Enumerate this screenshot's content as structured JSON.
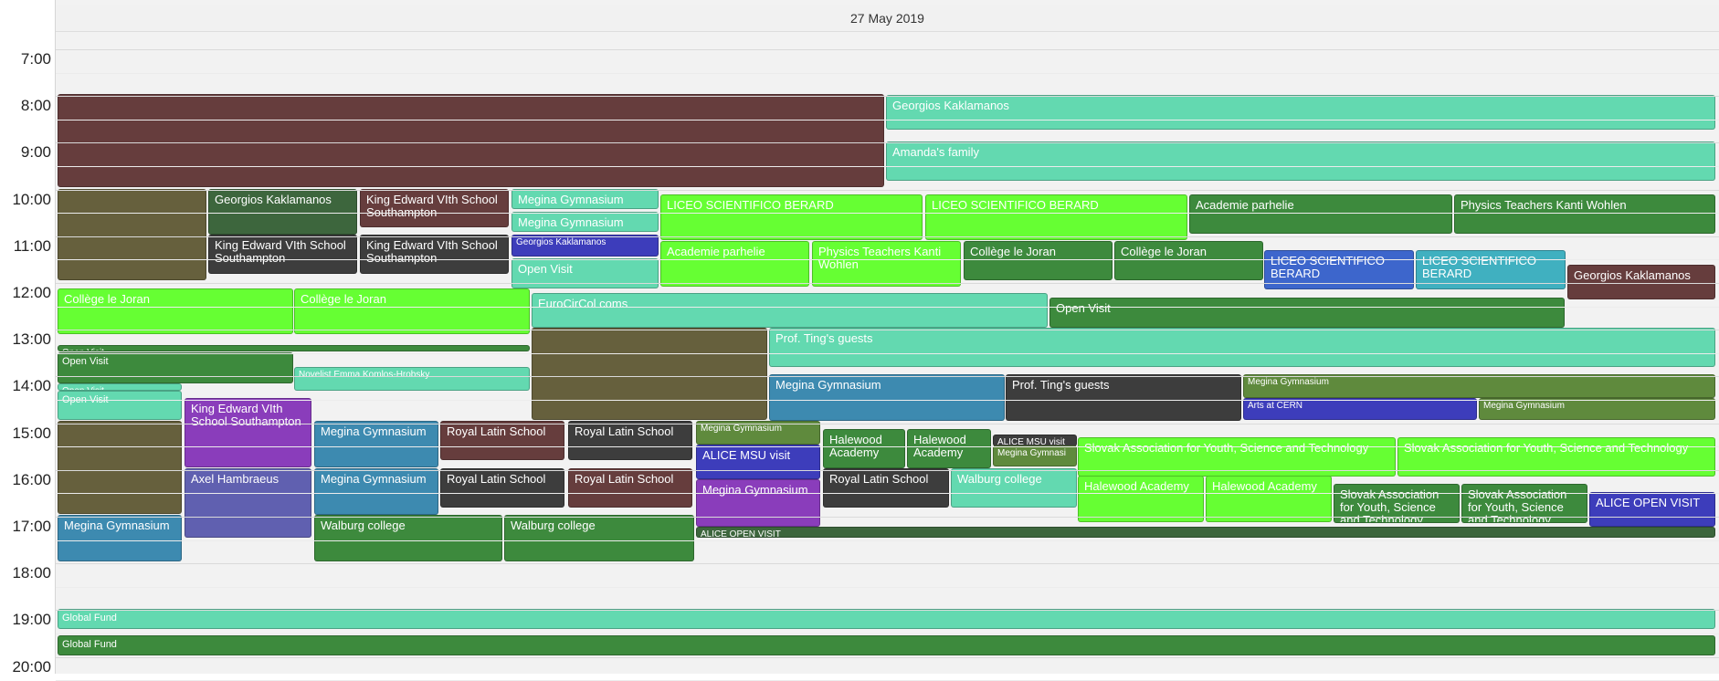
{
  "date_label": "27 May 2019",
  "hours": [
    "7:00",
    "8:00",
    "9:00",
    "10:00",
    "11:00",
    "12:00",
    "13:00",
    "14:00",
    "15:00",
    "16:00",
    "17:00",
    "18:00",
    "19:00",
    "20:00"
  ],
  "colors": {
    "maroon": "#663d3d",
    "olive": "#66603d",
    "darkgreen": "#3d663d",
    "mint": "#63d9b0",
    "lime": "#66ff33",
    "blue": "#3d66cc",
    "teal": "#40b0c0",
    "steel": "#3d8ab0",
    "dark": "#3d3d3d",
    "purple": "#8a3dbb",
    "indigo": "#3d3dbb",
    "slate": "#6060b0",
    "green": "#3d8a3d",
    "moss": "#5f8a3d"
  },
  "events": [
    {
      "id": "e1",
      "label": "",
      "color": "maroon"
    },
    {
      "id": "e2",
      "label": "Georgios Kaklamanos",
      "color": "mint"
    },
    {
      "id": "e3",
      "label": "Amanda's family",
      "color": "mint"
    },
    {
      "id": "e4",
      "label": "",
      "color": "olive"
    },
    {
      "id": "e5",
      "label": "Georgios Kaklamanos",
      "color": "darkgreen"
    },
    {
      "id": "e6",
      "label": "King Edward VIth School Southampton",
      "color": "maroon"
    },
    {
      "id": "e7",
      "label": "Megina Gymnasium",
      "color": "mint"
    },
    {
      "id": "e8",
      "label": "Megina Gymnasium",
      "color": "mint"
    },
    {
      "id": "e9",
      "label": "Georgios Kaklamanos",
      "color": "indigo"
    },
    {
      "id": "e10",
      "label": "Open Visit",
      "color": "mint"
    },
    {
      "id": "e11",
      "label": "LICEO SCIENTIFICO BERARD",
      "color": "lime"
    },
    {
      "id": "e12",
      "label": "LICEO SCIENTIFICO BERARD",
      "color": "lime"
    },
    {
      "id": "e13",
      "label": "Academie parhelie",
      "color": "green"
    },
    {
      "id": "e14",
      "label": "Physics Teachers Kanti Wohlen",
      "color": "green"
    },
    {
      "id": "e15",
      "label": "King Edward VIth School Southampton",
      "color": "dark"
    },
    {
      "id": "e16",
      "label": "King Edward VIth School Southampton",
      "color": "dark"
    },
    {
      "id": "e17",
      "label": "Academie parhelie",
      "color": "lime"
    },
    {
      "id": "e18",
      "label": "Physics Teachers Kanti Wohlen",
      "color": "lime"
    },
    {
      "id": "e19",
      "label": "Collège le Joran",
      "color": "green"
    },
    {
      "id": "e20",
      "label": "Collège le Joran",
      "color": "green"
    },
    {
      "id": "e21",
      "label": "LICEO SCIENTIFICO BERARD",
      "color": "blue"
    },
    {
      "id": "e22",
      "label": "LICEO SCIENTIFICO BERARD",
      "color": "teal"
    },
    {
      "id": "e23",
      "label": "Georgios Kaklamanos",
      "color": "maroon"
    },
    {
      "id": "e24",
      "label": "Collège le Joran",
      "color": "lime"
    },
    {
      "id": "e25",
      "label": "Collège le Joran",
      "color": "lime"
    },
    {
      "id": "e26",
      "label": "EuroCirCol coms",
      "color": "mint"
    },
    {
      "id": "e27",
      "label": "Open Visit",
      "color": "green"
    },
    {
      "id": "e28",
      "label": "",
      "color": "olive"
    },
    {
      "id": "e29",
      "label": "Prof. Ting's guests",
      "color": "mint"
    },
    {
      "id": "e30",
      "label": "Open Visit",
      "color": "green"
    },
    {
      "id": "e31",
      "label": "Open Visit",
      "color": "green"
    },
    {
      "id": "e32",
      "label": "Novelist Emma Komlos-Hrobsky",
      "color": "mint"
    },
    {
      "id": "e33",
      "label": "Open Visit",
      "color": "mint"
    },
    {
      "id": "e34",
      "label": "Megina Gymnasium",
      "color": "steel"
    },
    {
      "id": "e35",
      "label": "Prof. Ting's guests",
      "color": "dark"
    },
    {
      "id": "e36",
      "label": "Megina Gymnasium",
      "color": "moss"
    },
    {
      "id": "e37",
      "label": "Arts at CERN",
      "color": "indigo"
    },
    {
      "id": "e38",
      "label": "Megina Gymnasium",
      "color": "moss"
    },
    {
      "id": "e39",
      "label": "Open Visit",
      "color": "mint"
    },
    {
      "id": "e40",
      "label": "King Edward VIth School Southampton",
      "color": "purple"
    },
    {
      "id": "e41",
      "label": "",
      "color": "olive"
    },
    {
      "id": "e42",
      "label": "Megina Gymnasium",
      "color": "steel"
    },
    {
      "id": "e43",
      "label": "Royal Latin School",
      "color": "maroon"
    },
    {
      "id": "e44",
      "label": "Royal Latin School",
      "color": "dark"
    },
    {
      "id": "e45",
      "label": "Megina Gymnasium",
      "color": "moss"
    },
    {
      "id": "e46",
      "label": "ALICE MSU visit",
      "color": "indigo"
    },
    {
      "id": "e47",
      "label": "Halewood Academy",
      "color": "green"
    },
    {
      "id": "e48",
      "label": "Halewood Academy",
      "color": "green"
    },
    {
      "id": "e49",
      "label": "ALICE MSU visit",
      "color": "dark"
    },
    {
      "id": "e50",
      "label": "Megina Gymnasi",
      "color": "moss"
    },
    {
      "id": "e51",
      "label": "Slovak Association for Youth, Science and Technology",
      "color": "lime"
    },
    {
      "id": "e52",
      "label": "Slovak Association for Youth, Science and Technology",
      "color": "lime"
    },
    {
      "id": "e53",
      "label": "Axel Hambraeus",
      "color": "slate"
    },
    {
      "id": "e54",
      "label": "Megina Gymnasium",
      "color": "steel"
    },
    {
      "id": "e55",
      "label": "Royal Latin School",
      "color": "dark"
    },
    {
      "id": "e56",
      "label": "Royal Latin School",
      "color": "maroon"
    },
    {
      "id": "e57",
      "label": "Megina Gymnasium",
      "color": "purple"
    },
    {
      "id": "e58",
      "label": "Royal Latin School",
      "color": "dark"
    },
    {
      "id": "e59",
      "label": "Walburg college",
      "color": "mint"
    },
    {
      "id": "e60",
      "label": "Halewood Academy",
      "color": "lime"
    },
    {
      "id": "e61",
      "label": "Halewood Academy",
      "color": "lime"
    },
    {
      "id": "e62",
      "label": "Slovak Association for Youth, Science and Technology",
      "color": "green"
    },
    {
      "id": "e63",
      "label": "Slovak Association for Youth, Science and Technology",
      "color": "green"
    },
    {
      "id": "e64",
      "label": "ALICE OPEN VISIT",
      "color": "indigo"
    },
    {
      "id": "e65",
      "label": "Megina Gymnasium",
      "color": "steel"
    },
    {
      "id": "e66",
      "label": "Walburg college",
      "color": "green"
    },
    {
      "id": "e67",
      "label": "Walburg college",
      "color": "green"
    },
    {
      "id": "e68",
      "label": "ALICE OPEN VISIT",
      "color": "darkgreen"
    },
    {
      "id": "e69",
      "label": "Global Fund",
      "color": "mint"
    },
    {
      "id": "e70",
      "label": "Global Fund",
      "color": "green"
    }
  ]
}
